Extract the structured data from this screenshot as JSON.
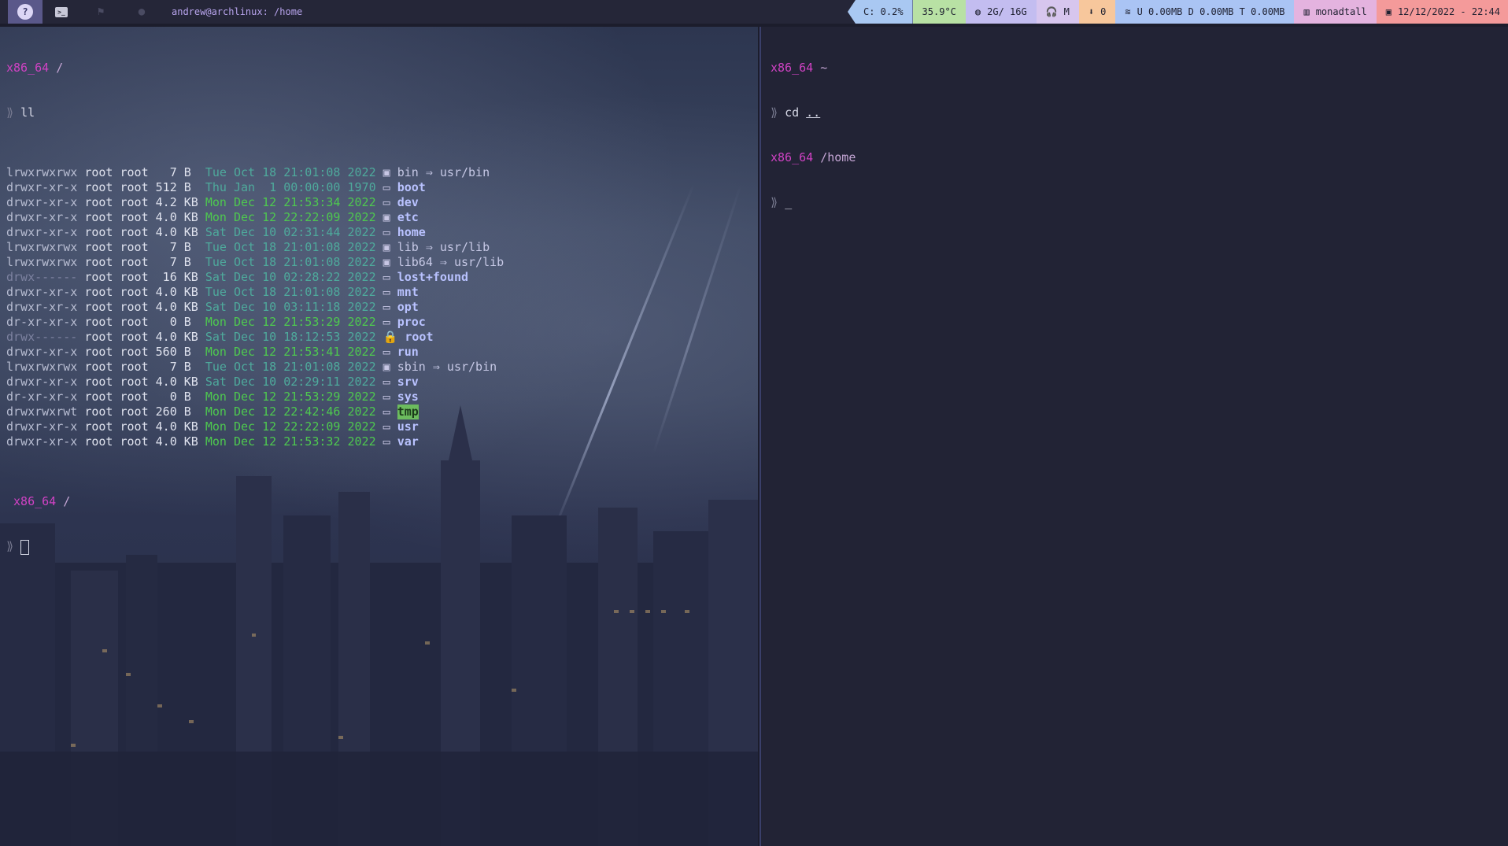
{
  "topbar": {
    "logo_char": "?",
    "term_icon": ">_",
    "ws3_icon": "⚑",
    "ws4_icon": "●",
    "window_title": "andrew@archlinux: /home",
    "cpu": "C: 0.2%",
    "temp": "35.9°C",
    "mem_icon": "◍",
    "mem": "2G/ 16G",
    "vol_icon": "🎧",
    "vol": "M",
    "updates_icon": "⬇",
    "updates": "0",
    "net_icon": "≋",
    "net": "U  0.00MB D  0.00MB T  0.00MB",
    "layout_icon": "▥",
    "layout": "monadtall",
    "clock_icon": "▣",
    "clock": "12/12/2022 - 22:44"
  },
  "left_terminal": {
    "prompt1": {
      "host": "x86_64",
      "path": "/"
    },
    "cmd1": {
      "chevron": "⟫",
      "text": "ll"
    },
    "rows": [
      {
        "perm": "lrwxrwxrwx",
        "dim": false,
        "u": "root",
        "g": "root",
        "size": "  7 B ",
        "date": "Tue Oct 18 21:01:08 2022",
        "new": false,
        "icon": "▣",
        "name": "bin",
        "link": " ⇒ usr/bin",
        "style": "link"
      },
      {
        "perm": "drwxr-xr-x",
        "dim": false,
        "u": "root",
        "g": "root",
        "size": "512 B ",
        "date": "Thu Jan  1 00:00:00 1970",
        "new": false,
        "icon": "▭",
        "name": "boot",
        "link": "",
        "style": "dir"
      },
      {
        "perm": "drwxr-xr-x",
        "dim": false,
        "u": "root",
        "g": "root",
        "size": "4.2 KB",
        "date": "Mon Dec 12 21:53:34 2022",
        "new": true,
        "icon": "▭",
        "name": "dev",
        "link": "",
        "style": "dir"
      },
      {
        "perm": "drwxr-xr-x",
        "dim": false,
        "u": "root",
        "g": "root",
        "size": "4.0 KB",
        "date": "Mon Dec 12 22:22:09 2022",
        "new": true,
        "icon": "▣",
        "name": "etc",
        "link": "",
        "style": "dir"
      },
      {
        "perm": "drwxr-xr-x",
        "dim": false,
        "u": "root",
        "g": "root",
        "size": "4.0 KB",
        "date": "Sat Dec 10 02:31:44 2022",
        "new": false,
        "icon": "▭",
        "name": "home",
        "link": "",
        "style": "dir"
      },
      {
        "perm": "lrwxrwxrwx",
        "dim": false,
        "u": "root",
        "g": "root",
        "size": "  7 B ",
        "date": "Tue Oct 18 21:01:08 2022",
        "new": false,
        "icon": "▣",
        "name": "lib",
        "link": " ⇒ usr/lib",
        "style": "link"
      },
      {
        "perm": "lrwxrwxrwx",
        "dim": false,
        "u": "root",
        "g": "root",
        "size": "  7 B ",
        "date": "Tue Oct 18 21:01:08 2022",
        "new": false,
        "icon": "▣",
        "name": "lib64",
        "link": " ⇒ usr/lib",
        "style": "link"
      },
      {
        "perm": "drwx------",
        "dim": true,
        "u": "root",
        "g": "root",
        "size": " 16 KB",
        "date": "Sat Dec 10 02:28:22 2022",
        "new": false,
        "icon": "▭",
        "name": "lost+found",
        "link": "",
        "style": "dir"
      },
      {
        "perm": "drwxr-xr-x",
        "dim": false,
        "u": "root",
        "g": "root",
        "size": "4.0 KB",
        "date": "Tue Oct 18 21:01:08 2022",
        "new": false,
        "icon": "▭",
        "name": "mnt",
        "link": "",
        "style": "dir"
      },
      {
        "perm": "drwxr-xr-x",
        "dim": false,
        "u": "root",
        "g": "root",
        "size": "4.0 KB",
        "date": "Sat Dec 10 03:11:18 2022",
        "new": false,
        "icon": "▭",
        "name": "opt",
        "link": "",
        "style": "dir"
      },
      {
        "perm": "dr-xr-xr-x",
        "dim": false,
        "u": "root",
        "g": "root",
        "size": "  0 B ",
        "date": "Mon Dec 12 21:53:29 2022",
        "new": true,
        "icon": "▭",
        "name": "proc",
        "link": "",
        "style": "dir"
      },
      {
        "perm": "drwx------",
        "dim": true,
        "u": "root",
        "g": "root",
        "size": "4.0 KB",
        "date": "Sat Dec 10 18:12:53 2022",
        "new": false,
        "icon": "🔒",
        "name": "root",
        "link": "",
        "style": "dir"
      },
      {
        "perm": "drwxr-xr-x",
        "dim": false,
        "u": "root",
        "g": "root",
        "size": "560 B ",
        "date": "Mon Dec 12 21:53:41 2022",
        "new": true,
        "icon": "▭",
        "name": "run",
        "link": "",
        "style": "dir"
      },
      {
        "perm": "lrwxrwxrwx",
        "dim": false,
        "u": "root",
        "g": "root",
        "size": "  7 B ",
        "date": "Tue Oct 18 21:01:08 2022",
        "new": false,
        "icon": "▣",
        "name": "sbin",
        "link": " ⇒ usr/bin",
        "style": "link"
      },
      {
        "perm": "drwxr-xr-x",
        "dim": false,
        "u": "root",
        "g": "root",
        "size": "4.0 KB",
        "date": "Sat Dec 10 02:29:11 2022",
        "new": false,
        "icon": "▭",
        "name": "srv",
        "link": "",
        "style": "dir"
      },
      {
        "perm": "dr-xr-xr-x",
        "dim": false,
        "u": "root",
        "g": "root",
        "size": "  0 B ",
        "date": "Mon Dec 12 21:53:29 2022",
        "new": true,
        "icon": "▭",
        "name": "sys",
        "link": "",
        "style": "dir"
      },
      {
        "perm": "drwxrwxrwt",
        "dim": false,
        "u": "root",
        "g": "root",
        "size": "260 B ",
        "date": "Mon Dec 12 22:42:46 2022",
        "new": true,
        "icon": "▭",
        "name": "tmp",
        "link": "",
        "style": "tmp"
      },
      {
        "perm": "drwxr-xr-x",
        "dim": false,
        "u": "root",
        "g": "root",
        "size": "4.0 KB",
        "date": "Mon Dec 12 22:22:09 2022",
        "new": true,
        "icon": "▭",
        "name": "usr",
        "link": "",
        "style": "dir"
      },
      {
        "perm": "drwxr-xr-x",
        "dim": false,
        "u": "root",
        "g": "root",
        "size": "4.0 KB",
        "date": "Mon Dec 12 21:53:32 2022",
        "new": true,
        "icon": "▭",
        "name": "var",
        "link": "",
        "style": "dir"
      }
    ],
    "prompt2": {
      "host": "x86_64",
      "path": "/"
    },
    "cmd2": {
      "chevron": "⟫"
    }
  },
  "right_terminal": {
    "prompt1": {
      "host": "x86_64",
      "path": "~"
    },
    "cmd1": {
      "chevron": "⟫",
      "text": "cd",
      "arg": ".."
    },
    "prompt2": {
      "host": "x86_64",
      "path": "/home"
    },
    "cmd2": {
      "chevron": "⟫",
      "cursor": "_"
    }
  },
  "colors": {
    "bar_bg": "#252638",
    "host": "#d042c4",
    "date_new": "#4ec94f",
    "date_old": "#4eaa9c",
    "dir_name": "#b9c2ff",
    "tmp_highlight": "#6cbc5e"
  }
}
